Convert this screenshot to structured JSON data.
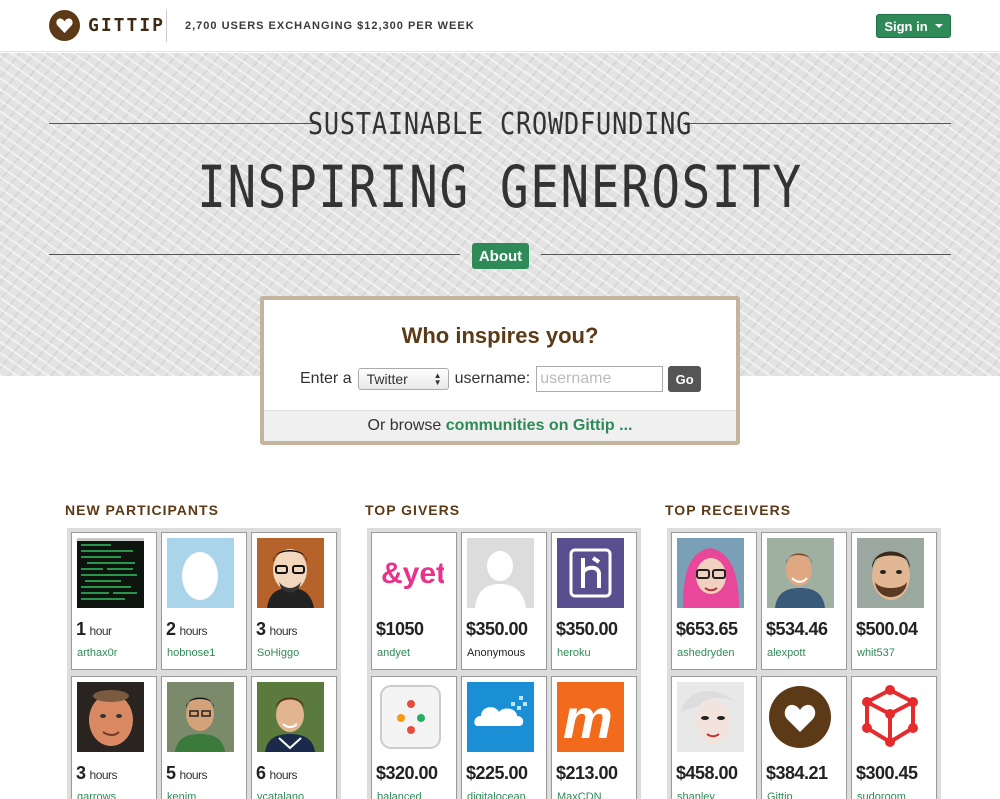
{
  "header": {
    "brand": "GITTIP",
    "tagline": "2,700 USERS EXCHANGING $12,300 PER WEEK",
    "signin_label": "Sign in",
    "logo_icon": "heart-icon"
  },
  "hero": {
    "subtitle": "SUSTAINABLE CROWDFUNDING",
    "headline": "INSPIRING GENEROSITY",
    "about_label": "About"
  },
  "inspire": {
    "title": "Who inspires you?",
    "enter_label": "Enter a",
    "platform_selected": "Twitter",
    "username_label": "username:",
    "username_placeholder": "username",
    "go_label": "Go",
    "browse_prefix": "Or browse",
    "browse_link": "communities on Gittip ..."
  },
  "columns": {
    "new_participants": {
      "title": "NEW PARTICIPANTS",
      "items": [
        {
          "num": "1",
          "unit": "hour",
          "user": "arthax0r"
        },
        {
          "num": "2",
          "unit": "hours",
          "user": "hobnose1"
        },
        {
          "num": "3",
          "unit": "hours",
          "user": "SoHiggo"
        },
        {
          "num": "3",
          "unit": "hours",
          "user": "garrows"
        },
        {
          "num": "5",
          "unit": "hours",
          "user": "kenim"
        },
        {
          "num": "6",
          "unit": "hours",
          "user": "vcatalano"
        }
      ]
    },
    "top_givers": {
      "title": "TOP GIVERS",
      "items": [
        {
          "amount": "$1050",
          "user": "andyet"
        },
        {
          "amount": "$350.00",
          "user": "Anonymous"
        },
        {
          "amount": "$350.00",
          "user": "heroku"
        },
        {
          "amount": "$320.00",
          "user": "balanced"
        },
        {
          "amount": "$225.00",
          "user": "digitalocean"
        },
        {
          "amount": "$213.00",
          "user": "MaxCDN"
        }
      ]
    },
    "top_receivers": {
      "title": "TOP RECEIVERS",
      "items": [
        {
          "amount": "$653.65",
          "user": "ashedryden"
        },
        {
          "amount": "$534.46",
          "user": "alexpott"
        },
        {
          "amount": "$500.04",
          "user": "whit537"
        },
        {
          "amount": "$458.00",
          "user": "shanley"
        },
        {
          "amount": "$384.21",
          "user": "Gittip"
        },
        {
          "amount": "$300.45",
          "user": "sudoroom"
        }
      ]
    }
  },
  "logos": {
    "andyet": "&yet",
    "maxcdn": "m"
  },
  "colors": {
    "brand_brown": "#5d3a17",
    "accent_green": "#2e8b57",
    "box_border": "#c4b39d"
  }
}
